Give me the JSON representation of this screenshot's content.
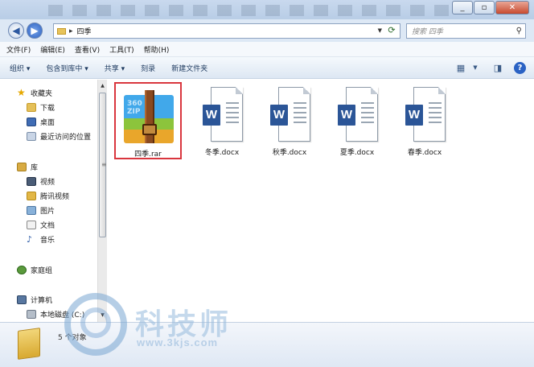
{
  "window": {
    "minimize_glyph": "_",
    "maximize_glyph": "▫",
    "close_glyph": "✕"
  },
  "nav": {
    "path_separator": "▸",
    "current_folder": "四季",
    "search_placeholder": "搜索 四季",
    "back_glyph": "◀",
    "forward_glyph": "▶"
  },
  "menu": {
    "items": [
      "文件(F)",
      "编辑(E)",
      "查看(V)",
      "工具(T)",
      "帮助(H)"
    ]
  },
  "toolbar": {
    "organize": "组织 ▾",
    "include_library": "包含到库中 ▾",
    "share": "共享 ▾",
    "burn": "刻录",
    "new_folder": "新建文件夹",
    "help": "?"
  },
  "navpane": {
    "favorites": "收藏夹",
    "downloads": "下载",
    "desktop": "桌面",
    "recent": "最近访问的位置",
    "libraries": "库",
    "videos": "视频",
    "tencent_video": "腾讯视频",
    "pictures": "图片",
    "documents": "文档",
    "music": "音乐",
    "homegroup": "家庭组",
    "computer": "计算机",
    "local_disk": "本地磁盘 (C:)"
  },
  "files": [
    {
      "name": "四季.rar",
      "type": "rar"
    },
    {
      "name": "冬季.docx",
      "type": "docx"
    },
    {
      "name": "秋季.docx",
      "type": "docx"
    },
    {
      "name": "夏季.docx",
      "type": "docx"
    },
    {
      "name": "春季.docx",
      "type": "docx"
    }
  ],
  "rar_icon_text": "360\nZIP",
  "docx_badge": "W",
  "details": {
    "item_count": "5 个对象"
  },
  "watermark": {
    "brand": "科技师",
    "url": "www.3kjs.com"
  }
}
